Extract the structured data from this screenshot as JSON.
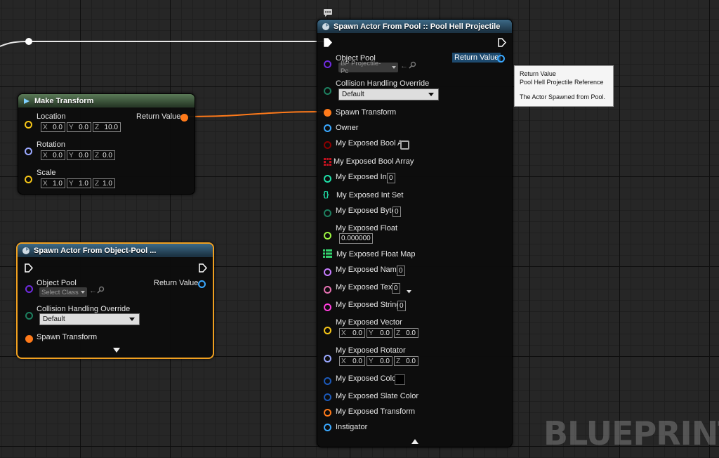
{
  "watermark": "BLUEPRINT",
  "colors": {
    "exec": "#ffffff",
    "object": "#3aa8ff",
    "struct_transform": "#ff7a1a",
    "struct_vector": "#f5c518",
    "struct_rotator": "#9aa8ff",
    "class": "#6f2be0",
    "enum": "#1d7f5f",
    "bool": "#8b0000",
    "int": "#1fe0a8",
    "float": "#9cf542",
    "name": "#c77dff",
    "text": "#e672b2",
    "string": "#ff3ddc",
    "color": "#1c59b8",
    "selected_outline": "#f0a020"
  },
  "make_transform": {
    "title": "Make Transform",
    "return_label": "Return Value",
    "location": {
      "label": "Location",
      "x": "0.0",
      "y": "0.0",
      "z": "10.0"
    },
    "rotation": {
      "label": "Rotation",
      "x": "0.0",
      "y": "0.0",
      "z": "0.0"
    },
    "scale": {
      "label": "Scale",
      "x": "1.0",
      "y": "1.0",
      "z": "1.0"
    }
  },
  "spawn_pool_node": {
    "title": "Spawn Actor From Object-Pool ...",
    "object_pool_label": "Object Pool",
    "object_pool_picker": "Select Class",
    "return_label": "Return Value",
    "collision_label": "Collision Handling Override",
    "collision_value": "Default",
    "spawn_transform_label": "Spawn Transform"
  },
  "spawn_actor_node": {
    "title": "Spawn Actor From Pool :: Pool Hell Projectile",
    "object_pool_label": "Object Pool",
    "object_pool_picker": "BP Projectile- Pc",
    "return_label": "Return Value",
    "collision_label": "Collision Handling Override",
    "collision_value": "Default",
    "spawn_transform_label": "Spawn Transform",
    "owner_label": "Owner",
    "bool_a_label": "My Exposed Bool A",
    "bool_array_label": "My Exposed Bool Array",
    "int_label": "My Exposed Int",
    "int_value": "0",
    "int_set_label": "My Exposed Int Set",
    "byte_label": "My Exposed Byte",
    "byte_value": "0",
    "float_label": "My Exposed Float",
    "float_value": "0.000000",
    "float_map_label": "My Exposed Float Map",
    "name_label": "My Exposed Name",
    "name_value": "0",
    "text_label": "My Exposed Text",
    "text_value": "0",
    "string_label": "My Exposed String",
    "string_value": "0",
    "vector": {
      "label": "My Exposed Vector",
      "x": "0.0",
      "y": "0.0",
      "z": "0.0"
    },
    "rotator": {
      "label": "My Exposed Rotator",
      "x": "0.0",
      "y": "0.0",
      "z": "0.0"
    },
    "color_label": "My Exposed Color",
    "slate_color_label": "My Exposed Slate Color",
    "transform_label": "My Exposed Transform",
    "instigator_label": "Instigator"
  },
  "tooltip": {
    "line1": "Return Value",
    "line2": "Pool Hell Projectile Reference",
    "line3": "The Actor Spawned from Pool."
  }
}
